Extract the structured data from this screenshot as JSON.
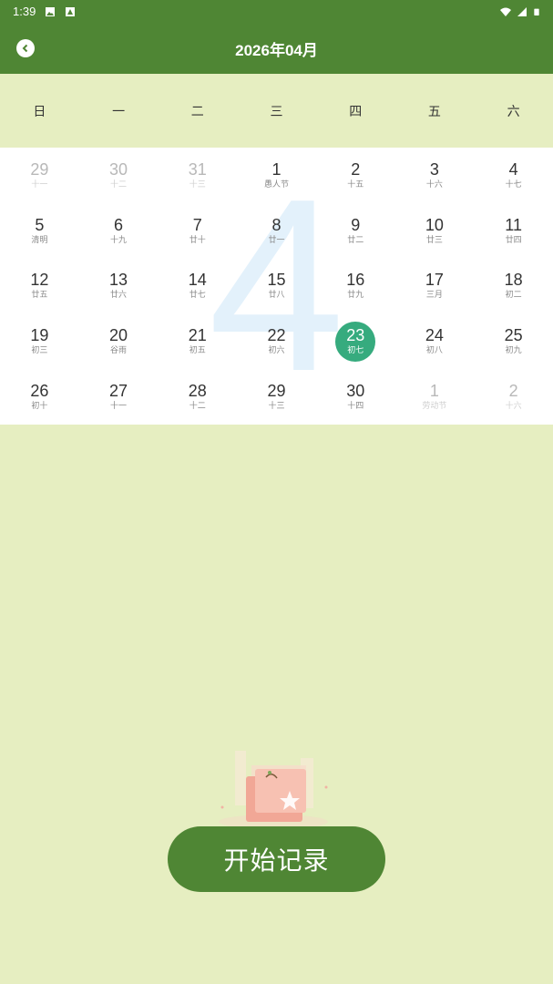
{
  "status_bar": {
    "time": "1:39",
    "icons": [
      "image-icon",
      "a-badge-icon",
      "wifi-icon",
      "signal-icon",
      "battery-icon"
    ]
  },
  "app_bar": {
    "title": "2026年04月",
    "back_icon": "chevron-left-icon"
  },
  "weekdays": [
    "日",
    "一",
    "二",
    "三",
    "四",
    "五",
    "六"
  ],
  "calendar": {
    "background_month": "4",
    "selected_day": "23",
    "weeks": [
      [
        {
          "num": "29",
          "sub": "十一",
          "other": true
        },
        {
          "num": "30",
          "sub": "十二",
          "other": true
        },
        {
          "num": "31",
          "sub": "十三",
          "other": true
        },
        {
          "num": "1",
          "sub": "愚人节",
          "other": false
        },
        {
          "num": "2",
          "sub": "十五",
          "other": false
        },
        {
          "num": "3",
          "sub": "十六",
          "other": false
        },
        {
          "num": "4",
          "sub": "十七",
          "other": false
        }
      ],
      [
        {
          "num": "5",
          "sub": "清明",
          "other": false
        },
        {
          "num": "6",
          "sub": "十九",
          "other": false
        },
        {
          "num": "7",
          "sub": "廿十",
          "other": false
        },
        {
          "num": "8",
          "sub": "廿一",
          "other": false
        },
        {
          "num": "9",
          "sub": "廿二",
          "other": false
        },
        {
          "num": "10",
          "sub": "廿三",
          "other": false
        },
        {
          "num": "11",
          "sub": "廿四",
          "other": false
        }
      ],
      [
        {
          "num": "12",
          "sub": "廿五",
          "other": false
        },
        {
          "num": "13",
          "sub": "廿六",
          "other": false
        },
        {
          "num": "14",
          "sub": "廿七",
          "other": false
        },
        {
          "num": "15",
          "sub": "廿八",
          "other": false
        },
        {
          "num": "16",
          "sub": "廿九",
          "other": false
        },
        {
          "num": "17",
          "sub": "三月",
          "other": false
        },
        {
          "num": "18",
          "sub": "初二",
          "other": false
        }
      ],
      [
        {
          "num": "19",
          "sub": "初三",
          "other": false
        },
        {
          "num": "20",
          "sub": "谷雨",
          "other": false
        },
        {
          "num": "21",
          "sub": "初五",
          "other": false
        },
        {
          "num": "22",
          "sub": "初六",
          "other": false
        },
        {
          "num": "23",
          "sub": "初七",
          "other": false,
          "selected": true
        },
        {
          "num": "24",
          "sub": "初八",
          "other": false
        },
        {
          "num": "25",
          "sub": "初九",
          "other": false
        }
      ],
      [
        {
          "num": "26",
          "sub": "初十",
          "other": false
        },
        {
          "num": "27",
          "sub": "十一",
          "other": false
        },
        {
          "num": "28",
          "sub": "十二",
          "other": false
        },
        {
          "num": "29",
          "sub": "十三",
          "other": false
        },
        {
          "num": "30",
          "sub": "十四",
          "other": false
        },
        {
          "num": "1",
          "sub": "劳动节",
          "other": true
        },
        {
          "num": "2",
          "sub": "十六",
          "other": true
        }
      ]
    ]
  },
  "start_button": {
    "label": "开始记录"
  },
  "colors": {
    "primary": "#4f8634",
    "background": "#e6eec1",
    "selected": "#36ab7e",
    "watermark": "#e3f1fb"
  }
}
